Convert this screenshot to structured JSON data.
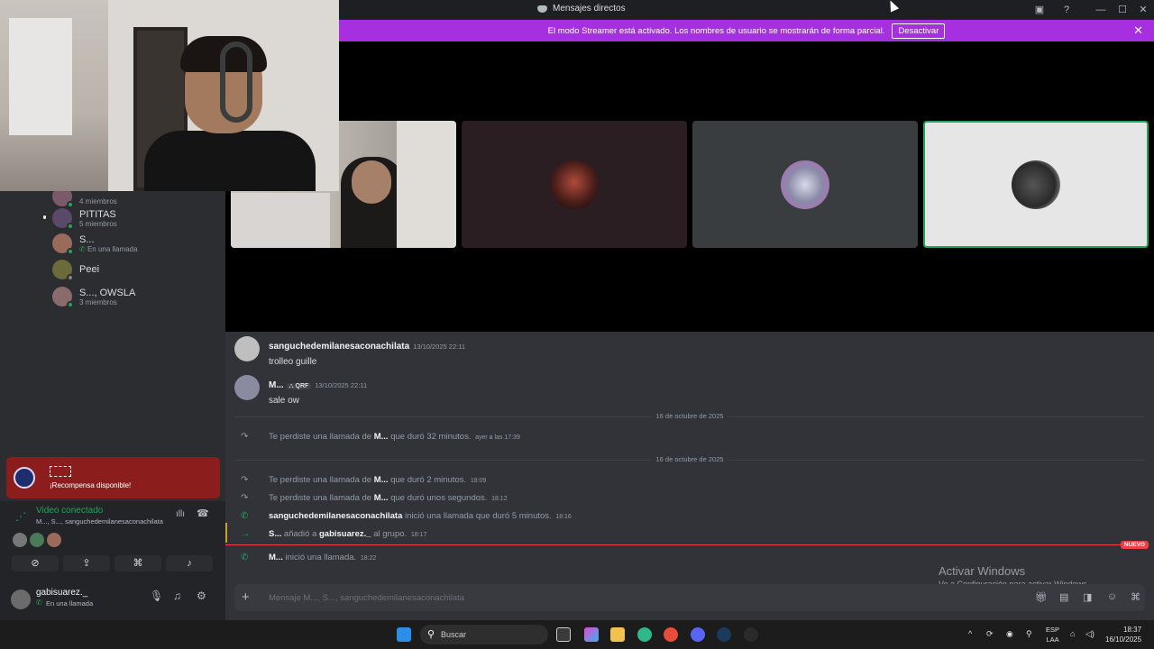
{
  "window": {
    "title": "Mensajes directos"
  },
  "banner": {
    "text": "El modo Streamer está activado. Los nombres de usuario se mostrarán de forma parcial.",
    "button": "Desactivar"
  },
  "sidebar": {
    "items": [
      {
        "name": "",
        "sub": "4 miembros"
      },
      {
        "name": "PITITAS",
        "sub": "5 miembros"
      },
      {
        "name": "S...",
        "sub": "En una llamada"
      },
      {
        "name": "Peei",
        "sub": ""
      },
      {
        "name": "S..., OWSLA",
        "sub": "3 miembros"
      }
    ]
  },
  "promo": {
    "text": "¡Recompensa disponible!"
  },
  "voice": {
    "status": "Video conectado",
    "channel": "M..., S..., sanguchedemilanesaconachilata"
  },
  "user": {
    "name": "gabisuarez._",
    "status": "En una llamada"
  },
  "messages": [
    {
      "author": "sanguchedemilanesaconachilata",
      "tag": "",
      "time": "13/10/2025 22:11",
      "text": "trolleo guille"
    },
    {
      "author": "M...",
      "tag": "QRF",
      "time": "13/10/2025 22:11",
      "text": "sale ow"
    }
  ],
  "dividers": [
    "16 de octubre de 2025",
    "16 de octubre de 2025"
  ],
  "system": [
    {
      "pre": "Te perdiste una llamada de ",
      "bold": "M...",
      "post": " que duró 32 minutos.",
      "time": "ayer a las 17:39"
    },
    {
      "pre": "Te perdiste una llamada de ",
      "bold": "M...",
      "post": " que duró 2 minutos.",
      "time": "18:09"
    },
    {
      "pre": "Te perdiste una llamada de ",
      "bold": "M...",
      "post": " que duró unos segundos.",
      "time": "18:12"
    },
    {
      "pre": "",
      "bold": "sanguchedemilanesaconachilata",
      "post": " inició una llamada que duró 5 minutos.",
      "time": "18:16"
    },
    {
      "pre": "",
      "bold": "S...",
      "post": " añadió a ",
      "bold2": "gabisuarez._",
      "post2": " al grupo.",
      "time": "18:17"
    },
    {
      "pre": "",
      "bold": "M...",
      "post": " inició una llamada.",
      "time": "18:22"
    }
  ],
  "new_badge": "NUEVO",
  "watermark": {
    "line1": "Activar Windows",
    "line2": "Ve a Configuración para activar Windows."
  },
  "composer": {
    "placeholder": "Mensaje M..., S..., sanguchedemilanesaconachilata"
  },
  "taskbar": {
    "search": "Buscar",
    "lang1": "ESP",
    "lang2": "LAA",
    "time": "18:37",
    "date": "16/10/2025"
  },
  "colors": {
    "banner": "#a62fe0",
    "online": "#23a55a",
    "promo": "#8c1d1d",
    "new": "#f23f43"
  }
}
